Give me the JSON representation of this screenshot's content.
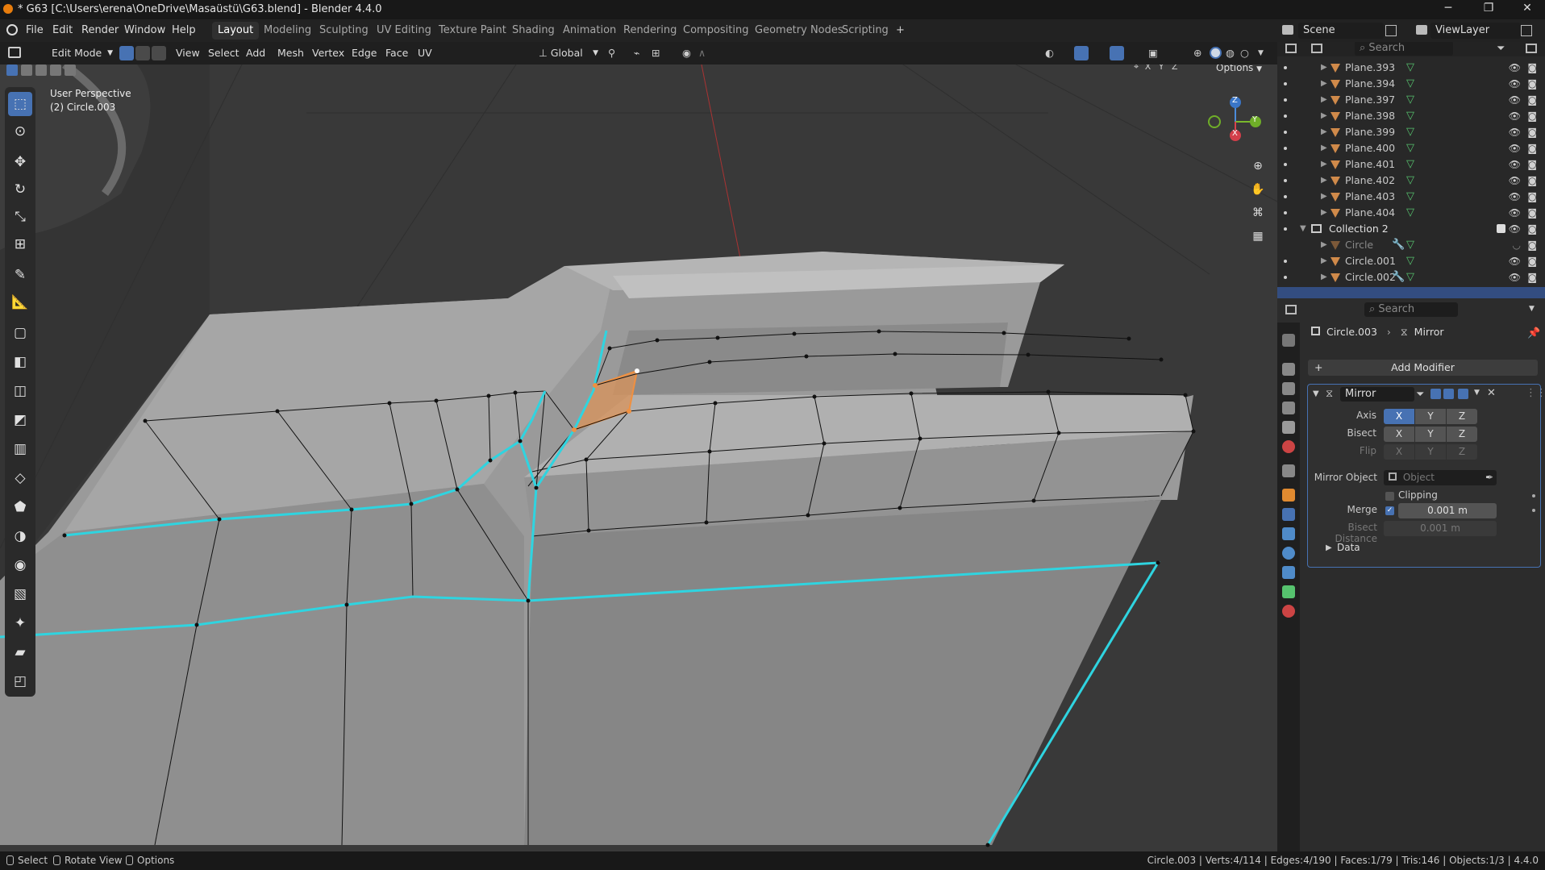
{
  "window": {
    "title": "* G63 [C:\\Users\\erena\\OneDrive\\Masaüstü\\G63.blend] - Blender 4.4.0",
    "controls": [
      "─",
      "❐",
      "✕"
    ]
  },
  "menubar": {
    "items": [
      "File",
      "Edit",
      "Render",
      "Window",
      "Help"
    ],
    "workspaces": [
      "Layout",
      "Modeling",
      "Sculpting",
      "UV Editing",
      "Texture Paint",
      "Shading",
      "Animation",
      "Rendering",
      "Compositing",
      "Geometry Nodes",
      "Scripting"
    ],
    "active_workspace": "Layout",
    "add_tab": "+",
    "scene": "Scene",
    "view_layer": "ViewLayer"
  },
  "viewport_header": {
    "mode": "Edit Mode",
    "menus": [
      "View",
      "Select",
      "Add",
      "Mesh",
      "Vertex",
      "Edge",
      "Face",
      "UV"
    ],
    "orientation": "Global",
    "axes": [
      "X",
      "Y",
      "Z"
    ],
    "options": "Options"
  },
  "viewport": {
    "view_name": "User Perspective",
    "object_info": "(2) Circle.003",
    "gizmo": {
      "z": "Z",
      "y": "Y",
      "x": "X"
    }
  },
  "outliner": {
    "search_placeholder": "Search",
    "items": [
      {
        "name": "Plane.393"
      },
      {
        "name": "Plane.394"
      },
      {
        "name": "Plane.397"
      },
      {
        "name": "Plane.398"
      },
      {
        "name": "Plane.399"
      },
      {
        "name": "Plane.400"
      },
      {
        "name": "Plane.401"
      },
      {
        "name": "Plane.402"
      },
      {
        "name": "Plane.403"
      },
      {
        "name": "Plane.404"
      }
    ],
    "collection": "Collection 2",
    "collection_items": [
      {
        "name": "Circle"
      },
      {
        "name": "Circle.001"
      },
      {
        "name": "Circle.002"
      }
    ]
  },
  "properties": {
    "search_placeholder": "Search",
    "breadcrumb_object": "Circle.003",
    "breadcrumb_modifier": "Mirror",
    "add_modifier": "Add Modifier",
    "modifier": {
      "name": "Mirror",
      "axis_label": "Axis",
      "bisect_label": "Bisect",
      "flip_label": "Flip",
      "axes": [
        "X",
        "Y",
        "Z"
      ],
      "mirror_object_label": "Mirror Object",
      "mirror_object_placeholder": "Object",
      "clipping_label": "Clipping",
      "merge_label": "Merge",
      "merge_value": "0.001 m",
      "bisect_distance_label": "Bisect Distance",
      "bisect_distance_value": "0.001 m",
      "data_label": "Data"
    }
  },
  "statusbar": {
    "select": "Select",
    "rotate": "Rotate View",
    "options": "Options",
    "stats": "Circle.003 | Verts:4/114 | Edges:4/190 | Faces:1/79 | Tris:146 | Objects:1/3 | 4.4.0"
  },
  "colors": {
    "accent": "#4772b3",
    "selected_edge": "#2fd4e0",
    "selected_face": "#e8883a"
  }
}
